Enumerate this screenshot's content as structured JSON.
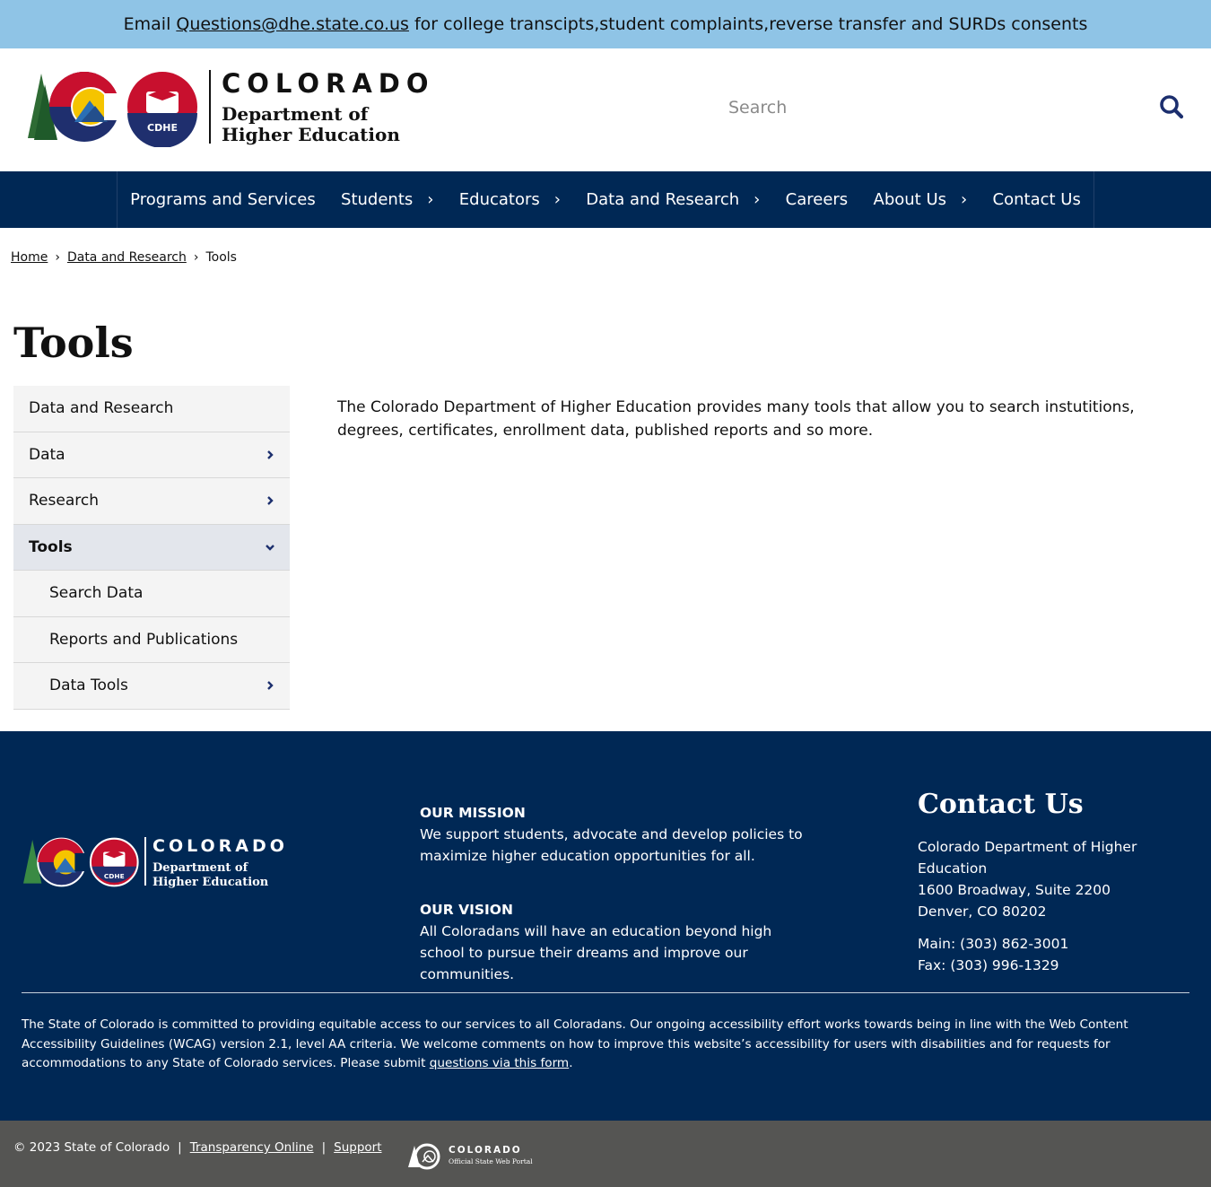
{
  "alert": {
    "prefix": "Email",
    "email": "Questions@dhe.state.co.us",
    "suffix": "for college transcipts,student complaints,reverse transfer and SURDs consents"
  },
  "header": {
    "logo_word_1": "COLORADO",
    "logo_word_2": "Department of",
    "logo_word_3": "Higher Education",
    "logo_badge": "CDHE",
    "search_placeholder": "Search"
  },
  "nav": {
    "items": [
      {
        "label": "Programs and Services",
        "has_submenu": false
      },
      {
        "label": "Students",
        "has_submenu": true
      },
      {
        "label": "Educators",
        "has_submenu": true
      },
      {
        "label": "Data and Research",
        "has_submenu": true
      },
      {
        "label": "Careers",
        "has_submenu": false
      },
      {
        "label": "About Us",
        "has_submenu": true
      },
      {
        "label": "Contact Us",
        "has_submenu": false
      }
    ]
  },
  "breadcrumb": {
    "items": [
      "Home",
      "Data and Research",
      "Tools"
    ],
    "separator": "›"
  },
  "page": {
    "title": "Tools",
    "intro": "The Colorado Department of Higher Education provides many tools that allow you to search instutitions, degrees, certificates, enrollment data, published reports and so more."
  },
  "sidenav": {
    "items": [
      {
        "label": "Data and Research",
        "chevron": "none",
        "level": 0
      },
      {
        "label": "Data",
        "chevron": "right",
        "level": 0
      },
      {
        "label": "Research",
        "chevron": "right",
        "level": 0
      },
      {
        "label": "Tools",
        "chevron": "down",
        "level": 0,
        "active": true
      },
      {
        "label": "Search Data",
        "chevron": "none",
        "level": 1
      },
      {
        "label": "Reports and Publications",
        "chevron": "none",
        "level": 1
      },
      {
        "label": "Data Tools",
        "chevron": "right",
        "level": 1
      }
    ]
  },
  "footer": {
    "logo_word_1": "COLORADO",
    "logo_word_2": "Department of",
    "logo_word_3": "Higher Education",
    "mission_heading": "OUR MISSION",
    "mission_text": "We support students, advocate and develop policies to maximize higher education opportunities for all.",
    "vision_heading": "OUR VISION",
    "vision_text": "All Coloradans will have an education beyond high school to pursue their dreams and improve our communities.",
    "contact_heading": "Contact Us",
    "contact_org": "Colorado Department of Higher Education",
    "contact_street": "1600 Broadway, Suite 2200",
    "contact_city": "Denver, CO 80202",
    "contact_main": "Main: (303) 862-3001",
    "contact_fax": "Fax: (303) 996-1329",
    "accessibility_text": "The State of Colorado is committed to providing equitable access to our services to all Coloradans. Our ongoing accessibility effort works towards being in line with the Web Content Accessibility Guidelines (WCAG) version 2.1, level AA criteria. We welcome comments on how to improve this website’s accessibility for users with disabilities and for requests for accommodations to any State of Colorado services. Please submit",
    "accessibility_link": "questions via this form",
    "accessibility_end": "."
  },
  "bottom": {
    "copyright": "© 2023 State of Colorado",
    "separator": "|",
    "link_1": "Transparency Online",
    "link_2": "Support",
    "portal_word_1": "COLORADO",
    "portal_word_2": "Official State Web Portal"
  },
  "colors": {
    "alert_bg": "#8fc4e6",
    "navy": "#002855",
    "bottom_bar": "#555553",
    "sidenav_bg": "#f4f4f4",
    "sidenav_active": "#e3e6ec"
  }
}
